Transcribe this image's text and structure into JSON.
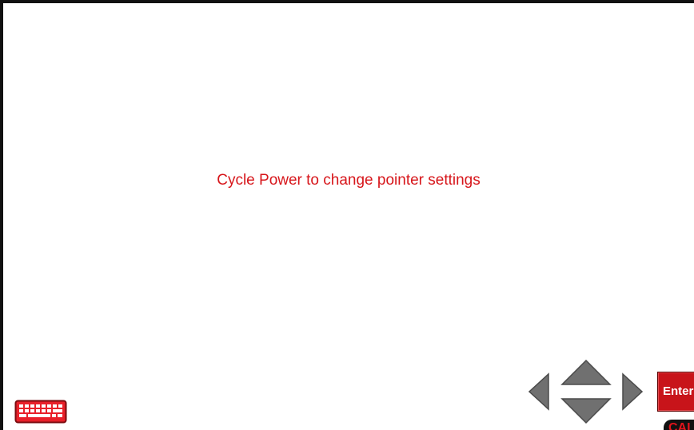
{
  "screen": {
    "message": "Cycle Power to change pointer settings",
    "message_color": "#d7161b"
  },
  "controls": {
    "keyboard_icon": "keyboard-icon",
    "arrows": {
      "left_icon": "arrow-left-icon",
      "up_icon": "arrow-up-icon",
      "down_icon": "arrow-down-icon",
      "right_icon": "arrow-right-icon",
      "color": "#707070"
    },
    "enter_label": "Enter",
    "enter_color": "#c8141a",
    "cal_label": "CAL",
    "cal_color": "#e0141b"
  }
}
